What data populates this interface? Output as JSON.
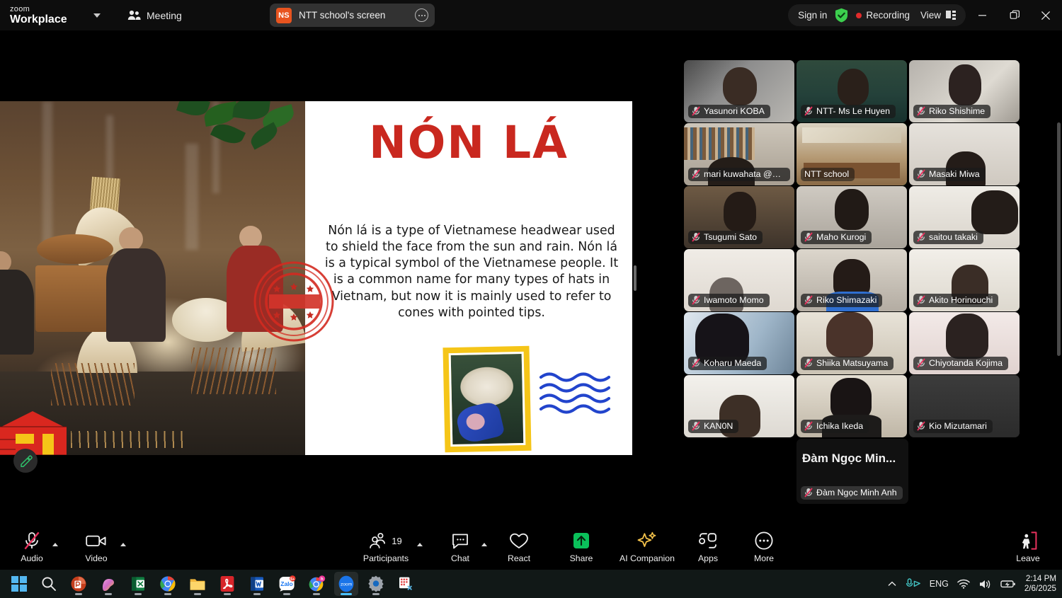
{
  "topbar": {
    "brand_line1": "zoom",
    "brand_line2": "Workplace",
    "meeting_tab": "Meeting",
    "share_tab": {
      "badge": "NS",
      "title": "NTT school's screen",
      "more_icon": "more-options-icon"
    },
    "sign_in": "Sign in",
    "recording": "Recording",
    "view": "View",
    "accent_orange": "#e8541f",
    "recording_red": "#e02b2b",
    "shield_green": "#3ccf4e"
  },
  "slide": {
    "title": "NÓN LÁ",
    "body": "Nón lá is a type of Vietnamese headwear used to shield the face from the sun and rain. Nón lá is a typical symbol of the Vietnamese people. It is a common name for many types of hats in Vietnam, but now it is mainly used to refer to cones with pointed tips.",
    "title_color": "#c9281f",
    "stamp_border_color": "#f5c518",
    "wave_color": "#2244cc",
    "photo_alt": "vietnamese-conical-hat-makers-photo",
    "stamp_alt": "conical-hat-boat-stamp-photo"
  },
  "gallery": {
    "participants": [
      {
        "name": "Yasunori KOBA",
        "muted": true,
        "active": false
      },
      {
        "name": "NTT- Ms Le Huyen",
        "muted": true,
        "active": false
      },
      {
        "name": "Riko Shishime",
        "muted": true,
        "active": false
      },
      {
        "name": "mari kuwahata @oomi...",
        "muted": true,
        "active": false
      },
      {
        "name": "NTT school",
        "muted": false,
        "active": true
      },
      {
        "name": "Masaki Miwa",
        "muted": true,
        "active": false
      },
      {
        "name": "Tsugumi Sato",
        "muted": true,
        "active": false
      },
      {
        "name": "Maho Kurogi",
        "muted": true,
        "active": false
      },
      {
        "name": "saitou takaki",
        "muted": true,
        "active": false
      },
      {
        "name": "Iwamoto Momo",
        "muted": true,
        "active": false
      },
      {
        "name": "Riko Shimazaki",
        "muted": true,
        "active": false
      },
      {
        "name": "Akito Horinouchi",
        "muted": true,
        "active": false
      },
      {
        "name": "Koharu Maeda",
        "muted": true,
        "active": false
      },
      {
        "name": "Shiika Matsuyama",
        "muted": true,
        "active": false
      },
      {
        "name": "Chiyotanda Kojima",
        "muted": true,
        "active": false
      },
      {
        "name": "KAN0N",
        "muted": true,
        "active": false
      },
      {
        "name": "Ichika Ikeda",
        "muted": true,
        "active": false
      },
      {
        "name": "Kio Mizutamari",
        "muted": true,
        "active": false
      }
    ],
    "spotlight": {
      "display_name": "Đàm Ngọc Min...",
      "name": "Đàm Ngọc Minh Anh",
      "muted": true
    },
    "active_border_color": "#3ae36a"
  },
  "toolbar": {
    "audio": "Audio",
    "video": "Video",
    "participants": "Participants",
    "participants_count": "19",
    "chat": "Chat",
    "react": "React",
    "share": "Share",
    "ai_companion": "AI Companion",
    "apps": "Apps",
    "more": "More",
    "leave": "Leave",
    "share_green": "#0ac05a",
    "leave_red": "#e8315d",
    "mute_slash_red": "#e8315d"
  },
  "taskbar": {
    "apps": [
      {
        "name": "start-button",
        "label": "Start"
      },
      {
        "name": "search-icon",
        "label": "Search"
      },
      {
        "name": "powerpoint-icon",
        "label": "PowerPoint"
      },
      {
        "name": "copilot-icon",
        "label": "Copilot"
      },
      {
        "name": "excel-icon",
        "label": "Excel"
      },
      {
        "name": "chrome-icon",
        "label": "Google Chrome"
      },
      {
        "name": "file-explorer-icon",
        "label": "File Explorer"
      },
      {
        "name": "acrobat-icon",
        "label": "Adobe Acrobat"
      },
      {
        "name": "word-icon",
        "label": "Word"
      },
      {
        "name": "zalo-icon",
        "label": "Zalo",
        "badge": "5+"
      },
      {
        "name": "chrome-secondary-icon",
        "label": "Chrome",
        "badge": "h"
      },
      {
        "name": "zoom-icon",
        "label": "Zoom"
      },
      {
        "name": "settings-icon",
        "label": "Settings"
      },
      {
        "name": "snipping-tool-icon",
        "label": "Snipping Tool"
      }
    ],
    "tray": {
      "language": "ENG",
      "time": "2:14 PM",
      "date": "2/6/2025",
      "icons": [
        "chevron-up-icon",
        "mic-icon",
        "wifi-icon",
        "speaker-icon",
        "battery-icon"
      ]
    }
  }
}
